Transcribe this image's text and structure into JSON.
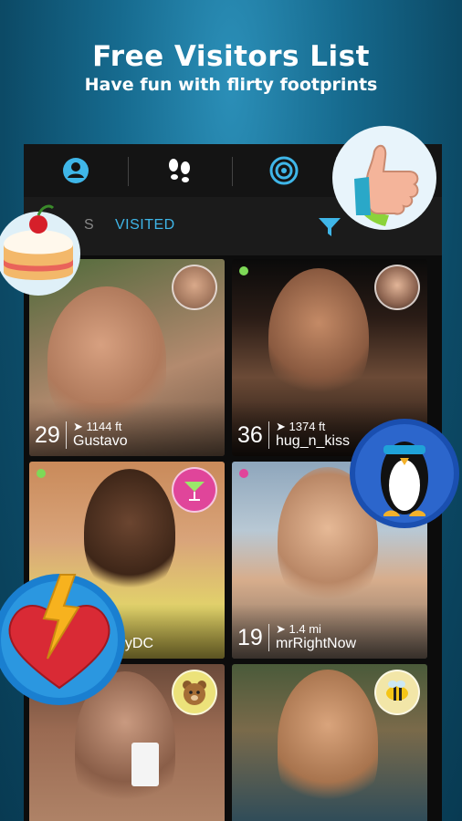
{
  "promo": {
    "title": "Free Visitors List",
    "subtitle": "Have fun with flirty footprints"
  },
  "tabs": [
    {
      "icon": "profile-icon"
    },
    {
      "icon": "footprints-icon"
    },
    {
      "icon": "radar-icon"
    },
    {
      "icon": "messages-icon"
    }
  ],
  "subtabs": {
    "visitors_partial": "S",
    "visited": "VISITED",
    "filter_icon": "filter-icon"
  },
  "colors": {
    "accent": "#3fb6e8",
    "online_green": "#7ed957",
    "online_pink": "#e0459a"
  },
  "profiles": [
    {
      "age": "29",
      "distance": "1144 ft",
      "name": "Gustavo",
      "online": "green"
    },
    {
      "age": "36",
      "distance": "1374 ft",
      "name": "hug_n_kiss",
      "online": "green"
    },
    {
      "age": "",
      "distance": "",
      "name": "uyDC",
      "online": "green"
    },
    {
      "age": "19",
      "distance": "1.4 mi",
      "name": "mrRightNow",
      "online": "pink"
    },
    {
      "age": "",
      "distance": "",
      "name": "",
      "online": ""
    },
    {
      "age": "",
      "distance": "",
      "name": "",
      "online": ""
    }
  ]
}
